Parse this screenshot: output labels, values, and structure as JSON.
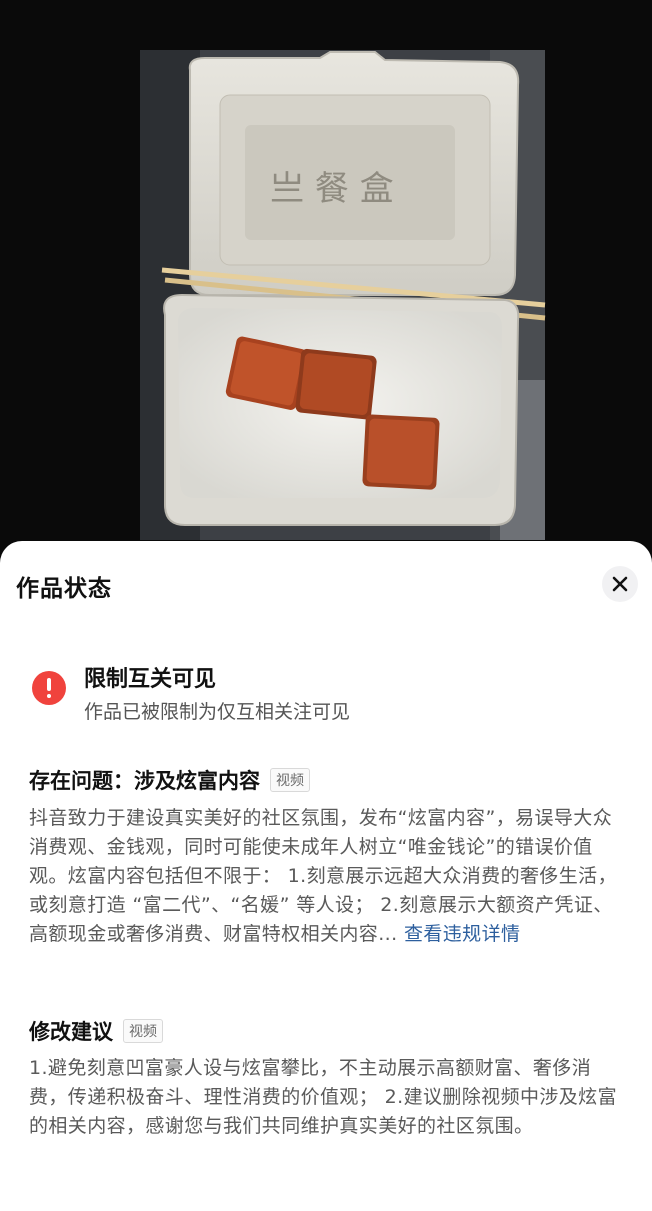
{
  "sheet": {
    "title": "作品状态",
    "close_icon": "close-icon",
    "status": {
      "icon": "alert-icon",
      "icon_color": "#f0433d",
      "title": "限制互关可见",
      "description": "作品已被限制为仅互相关注可见"
    },
    "issue": {
      "heading": "存在问题：涉及炫富内容",
      "tag": "视频",
      "text": "抖音致力于建设真实美好的社区氛围，发布“炫富内容”，易误导大众消费观、金钱观，同时可能使未成年人树立“唯金钱论”的错误价值观。炫富内容包括但不限于： 1.刻意展示远超大众消费的奢侈生活，或刻意打造 “富二代”、“名媛” 等人设； 2.刻意展示大额资产凭证、高额现金或奢侈消费、财富特权相关内容...",
      "link": "查看违规详情",
      "link_color": "#2d5f9e"
    },
    "suggestion": {
      "heading": "修改建议",
      "tag": "视频",
      "text": "1.避免刻意凹富豪人设与炫富攀比，不主动展示高额财富、奢侈消费，传递积极奋斗、理性消费的价值观； 2.建议删除视频中涉及炫富的相关内容，感谢您与我们共同维护真实美好的社区氛围。"
    }
  }
}
